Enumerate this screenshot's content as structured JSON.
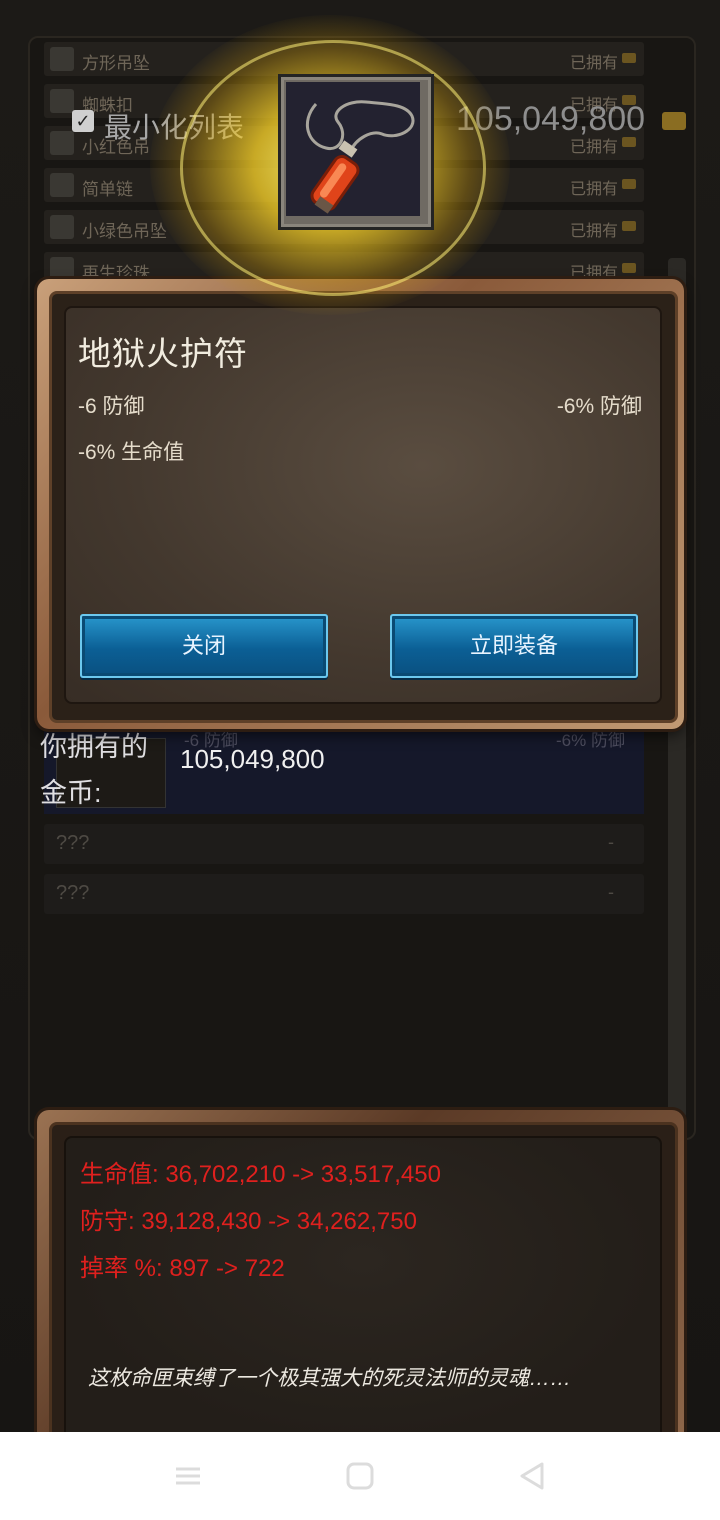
{
  "background_list": {
    "rows": [
      {
        "name": "方形吊坠",
        "status": "已拥有"
      },
      {
        "name": "蜘蛛扣",
        "status": "已拥有"
      },
      {
        "name": "小红色吊",
        "status": "已拥有"
      },
      {
        "name": "简单链",
        "status": "已拥有"
      },
      {
        "name": "小绿色吊坠",
        "status": "已拥有"
      },
      {
        "name": "再生珍珠",
        "status": "已拥有"
      }
    ],
    "minimize_label": "最小化列表",
    "gold_top": "105,049,800",
    "selected_row": {
      "left_stat": "-6 防御",
      "right_stat": "-6% 防御"
    },
    "unknown_rows": [
      {
        "name": "???",
        "value": "-"
      },
      {
        "name": "???",
        "value": "-"
      }
    ]
  },
  "gold_owned": {
    "label_line1": "你拥有的",
    "label_line2": "金币:",
    "value": "105,049,800"
  },
  "item_dialog": {
    "title": "地狱火护符",
    "stat_left_1": "-6 防御",
    "stat_right_1": "-6% 防御",
    "stat_left_2": "-6% 生命值",
    "close_label": "关闭",
    "equip_label": "立即装备"
  },
  "stats_panel": {
    "hp_line": "生命值: 36,702,210 -> 33,517,450",
    "def_line": "防守: 39,128,430 -> 34,262,750",
    "drop_line": "掉率 %: 897 -> 722",
    "flavor_text": "这枚命匣束缚了一个极其强大的死灵法师的灵魂……"
  },
  "colors": {
    "stat_change_red": "#e0201e",
    "button_blue": "#0b5f95",
    "glow_gold": "#ffd728"
  },
  "icons": {
    "item": "amulet-red-vial-icon",
    "coin": "gold-coin-icon",
    "nav": [
      "menu-icon",
      "home-icon",
      "back-icon"
    ]
  }
}
